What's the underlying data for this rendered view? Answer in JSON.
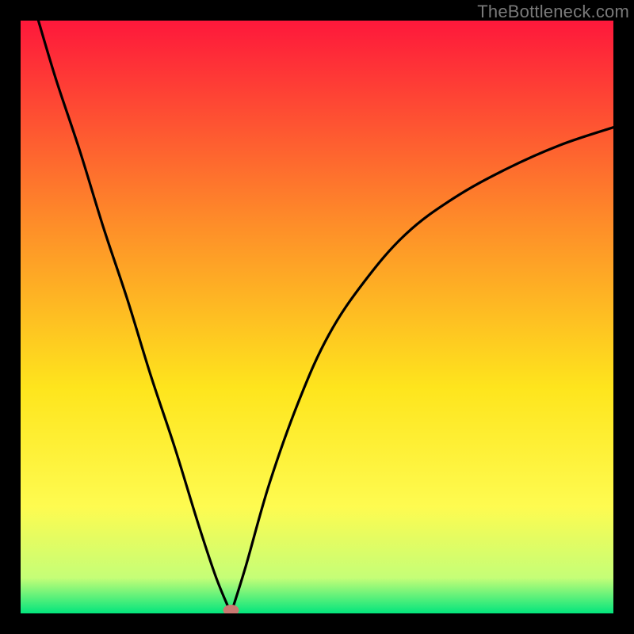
{
  "watermark": "TheBottleneck.com",
  "colors": {
    "top": "#fe183b",
    "upper_mid": "#fe8c29",
    "mid": "#fee51d",
    "lower_mid": "#fefb50",
    "near_bottom": "#c5fe77",
    "bottom": "#03e57d",
    "frame": "#000000",
    "curve": "#000000",
    "marker": "#c97871"
  },
  "chart_data": {
    "type": "line",
    "title": "",
    "xlabel": "",
    "ylabel": "",
    "xlim": [
      0,
      100
    ],
    "ylim": [
      0,
      100
    ],
    "minimum": {
      "x": 35.5,
      "y": 0
    },
    "series": [
      {
        "name": "left-branch",
        "x": [
          3,
          6,
          10,
          14,
          18,
          22,
          26,
          30,
          33,
          35.5
        ],
        "values": [
          100,
          90,
          78,
          65,
          53,
          40,
          28,
          15,
          6,
          0
        ]
      },
      {
        "name": "right-branch",
        "x": [
          35.5,
          38,
          42,
          47,
          52,
          58,
          65,
          73,
          82,
          91,
          100
        ],
        "values": [
          0,
          8,
          22,
          36,
          47,
          56,
          64,
          70,
          75,
          79,
          82
        ]
      }
    ],
    "annotations": [
      {
        "name": "minimum-marker",
        "x": 35.5,
        "y": 0
      }
    ]
  }
}
